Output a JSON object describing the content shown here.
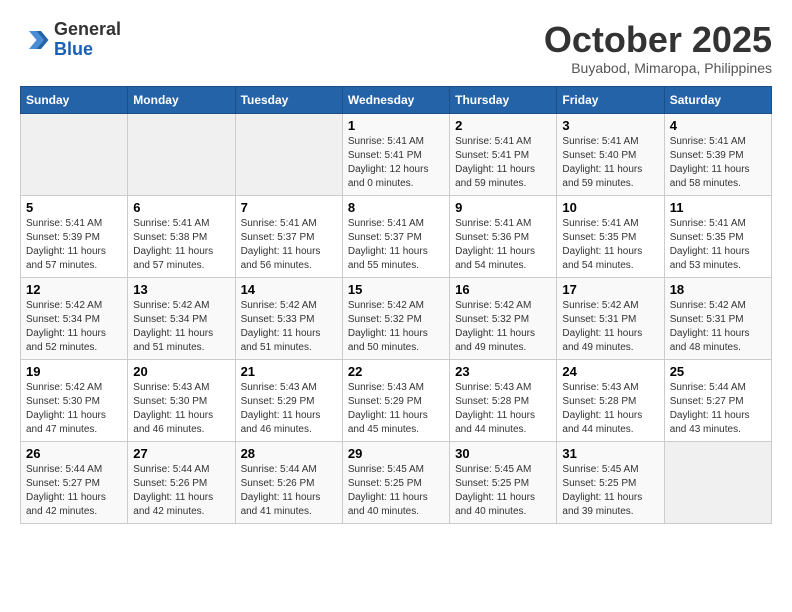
{
  "header": {
    "logo_line1": "General",
    "logo_line2": "Blue",
    "title": "October 2025",
    "subtitle": "Buyabod, Mimaropa, Philippines"
  },
  "weekdays": [
    "Sunday",
    "Monday",
    "Tuesday",
    "Wednesday",
    "Thursday",
    "Friday",
    "Saturday"
  ],
  "weeks": [
    [
      {
        "day": "",
        "info": ""
      },
      {
        "day": "",
        "info": ""
      },
      {
        "day": "",
        "info": ""
      },
      {
        "day": "1",
        "info": "Sunrise: 5:41 AM\nSunset: 5:41 PM\nDaylight: 12 hours and 0 minutes."
      },
      {
        "day": "2",
        "info": "Sunrise: 5:41 AM\nSunset: 5:41 PM\nDaylight: 11 hours and 59 minutes."
      },
      {
        "day": "3",
        "info": "Sunrise: 5:41 AM\nSunset: 5:40 PM\nDaylight: 11 hours and 59 minutes."
      },
      {
        "day": "4",
        "info": "Sunrise: 5:41 AM\nSunset: 5:39 PM\nDaylight: 11 hours and 58 minutes."
      }
    ],
    [
      {
        "day": "5",
        "info": "Sunrise: 5:41 AM\nSunset: 5:39 PM\nDaylight: 11 hours and 57 minutes."
      },
      {
        "day": "6",
        "info": "Sunrise: 5:41 AM\nSunset: 5:38 PM\nDaylight: 11 hours and 57 minutes."
      },
      {
        "day": "7",
        "info": "Sunrise: 5:41 AM\nSunset: 5:37 PM\nDaylight: 11 hours and 56 minutes."
      },
      {
        "day": "8",
        "info": "Sunrise: 5:41 AM\nSunset: 5:37 PM\nDaylight: 11 hours and 55 minutes."
      },
      {
        "day": "9",
        "info": "Sunrise: 5:41 AM\nSunset: 5:36 PM\nDaylight: 11 hours and 54 minutes."
      },
      {
        "day": "10",
        "info": "Sunrise: 5:41 AM\nSunset: 5:35 PM\nDaylight: 11 hours and 54 minutes."
      },
      {
        "day": "11",
        "info": "Sunrise: 5:41 AM\nSunset: 5:35 PM\nDaylight: 11 hours and 53 minutes."
      }
    ],
    [
      {
        "day": "12",
        "info": "Sunrise: 5:42 AM\nSunset: 5:34 PM\nDaylight: 11 hours and 52 minutes."
      },
      {
        "day": "13",
        "info": "Sunrise: 5:42 AM\nSunset: 5:34 PM\nDaylight: 11 hours and 51 minutes."
      },
      {
        "day": "14",
        "info": "Sunrise: 5:42 AM\nSunset: 5:33 PM\nDaylight: 11 hours and 51 minutes."
      },
      {
        "day": "15",
        "info": "Sunrise: 5:42 AM\nSunset: 5:32 PM\nDaylight: 11 hours and 50 minutes."
      },
      {
        "day": "16",
        "info": "Sunrise: 5:42 AM\nSunset: 5:32 PM\nDaylight: 11 hours and 49 minutes."
      },
      {
        "day": "17",
        "info": "Sunrise: 5:42 AM\nSunset: 5:31 PM\nDaylight: 11 hours and 49 minutes."
      },
      {
        "day": "18",
        "info": "Sunrise: 5:42 AM\nSunset: 5:31 PM\nDaylight: 11 hours and 48 minutes."
      }
    ],
    [
      {
        "day": "19",
        "info": "Sunrise: 5:42 AM\nSunset: 5:30 PM\nDaylight: 11 hours and 47 minutes."
      },
      {
        "day": "20",
        "info": "Sunrise: 5:43 AM\nSunset: 5:30 PM\nDaylight: 11 hours and 46 minutes."
      },
      {
        "day": "21",
        "info": "Sunrise: 5:43 AM\nSunset: 5:29 PM\nDaylight: 11 hours and 46 minutes."
      },
      {
        "day": "22",
        "info": "Sunrise: 5:43 AM\nSunset: 5:29 PM\nDaylight: 11 hours and 45 minutes."
      },
      {
        "day": "23",
        "info": "Sunrise: 5:43 AM\nSunset: 5:28 PM\nDaylight: 11 hours and 44 minutes."
      },
      {
        "day": "24",
        "info": "Sunrise: 5:43 AM\nSunset: 5:28 PM\nDaylight: 11 hours and 44 minutes."
      },
      {
        "day": "25",
        "info": "Sunrise: 5:44 AM\nSunset: 5:27 PM\nDaylight: 11 hours and 43 minutes."
      }
    ],
    [
      {
        "day": "26",
        "info": "Sunrise: 5:44 AM\nSunset: 5:27 PM\nDaylight: 11 hours and 42 minutes."
      },
      {
        "day": "27",
        "info": "Sunrise: 5:44 AM\nSunset: 5:26 PM\nDaylight: 11 hours and 42 minutes."
      },
      {
        "day": "28",
        "info": "Sunrise: 5:44 AM\nSunset: 5:26 PM\nDaylight: 11 hours and 41 minutes."
      },
      {
        "day": "29",
        "info": "Sunrise: 5:45 AM\nSunset: 5:25 PM\nDaylight: 11 hours and 40 minutes."
      },
      {
        "day": "30",
        "info": "Sunrise: 5:45 AM\nSunset: 5:25 PM\nDaylight: 11 hours and 40 minutes."
      },
      {
        "day": "31",
        "info": "Sunrise: 5:45 AM\nSunset: 5:25 PM\nDaylight: 11 hours and 39 minutes."
      },
      {
        "day": "",
        "info": ""
      }
    ]
  ]
}
